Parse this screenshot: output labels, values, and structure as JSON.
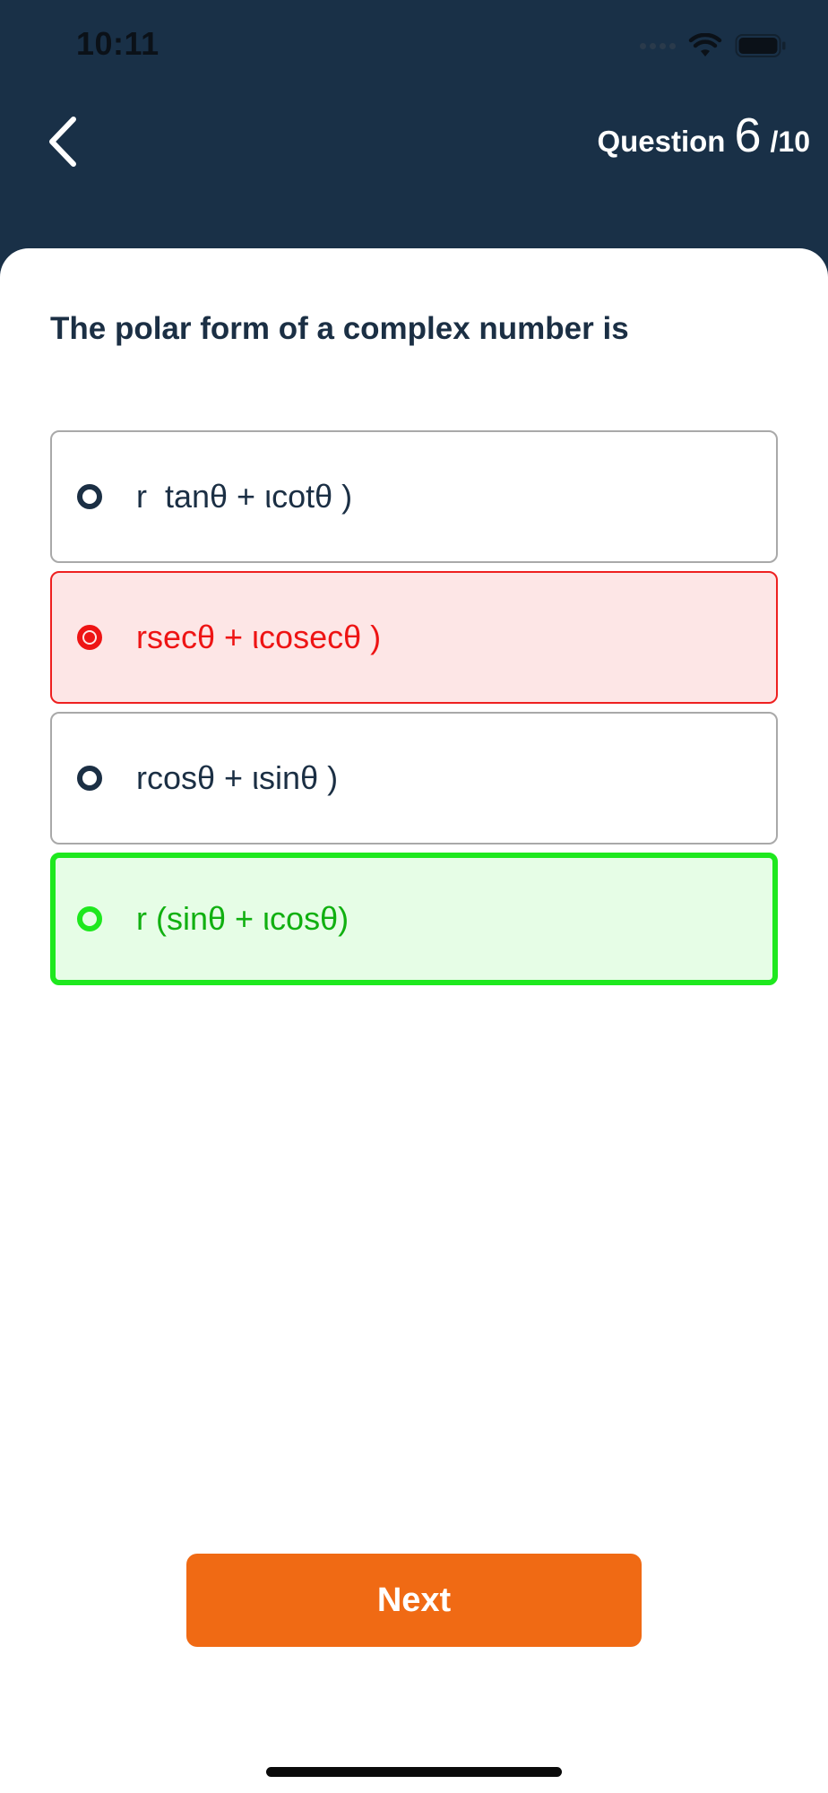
{
  "status_bar": {
    "time": "10:11"
  },
  "header": {
    "question_label": "Question",
    "question_number": "6",
    "question_total": "/10"
  },
  "question": {
    "text": "The polar form of a complex number is"
  },
  "options": [
    {
      "label": "r  tanθ + ιcotθ )",
      "state": "default"
    },
    {
      "label": "rsecθ + ιcosecθ )",
      "state": "wrong-selected"
    },
    {
      "label": "rcosθ + ιsinθ )",
      "state": "default"
    },
    {
      "label": "r (sinθ + ιcosθ)",
      "state": "correct"
    }
  ],
  "actions": {
    "next_label": "Next"
  },
  "icons": {
    "back": "chevron-left-icon",
    "signal": "cellular-signal-icon",
    "wifi": "wifi-icon",
    "battery": "battery-icon"
  },
  "colors": {
    "header_bg": "#193047",
    "accent_orange": "#f06a14",
    "wrong_red": "#ee1414",
    "wrong_bg": "#fde6e6",
    "correct_green": "#1ee81e",
    "correct_bg": "#e6fde6",
    "text_dark": "#1b2f44"
  }
}
